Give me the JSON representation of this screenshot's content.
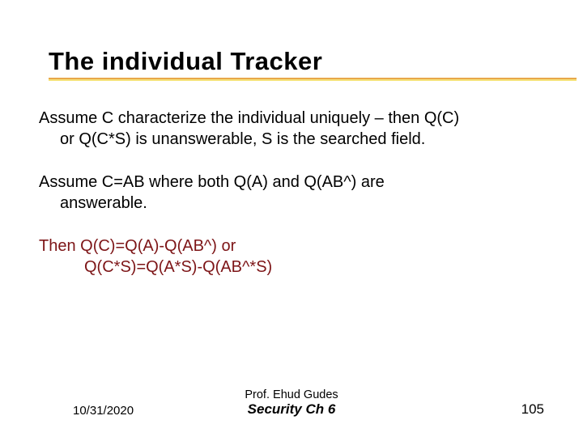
{
  "title": "The individual Tracker",
  "body": {
    "p1_l1": "Assume C characterize the individual uniquely – then Q(C)",
    "p1_l2": "or Q(C*S) is unanswerable, S is the searched field.",
    "p2_l1": "Assume C=AB where both Q(A) and Q(AB^) are",
    "p2_l2": "answerable.",
    "p3_l1": "Then   Q(C)=Q(A)-Q(AB^)  or",
    "p3_l2": "     Q(C*S)=Q(A*S)-Q(AB^*S)"
  },
  "footer": {
    "date": "10/31/2020",
    "prof": "Prof. Ehud Gudes",
    "course": "Security  Ch 6",
    "page": "105"
  },
  "colors": {
    "maroon": "#7d1517",
    "underline_orange": "#e8a84a",
    "underline_yellow": "#f6e27a"
  }
}
